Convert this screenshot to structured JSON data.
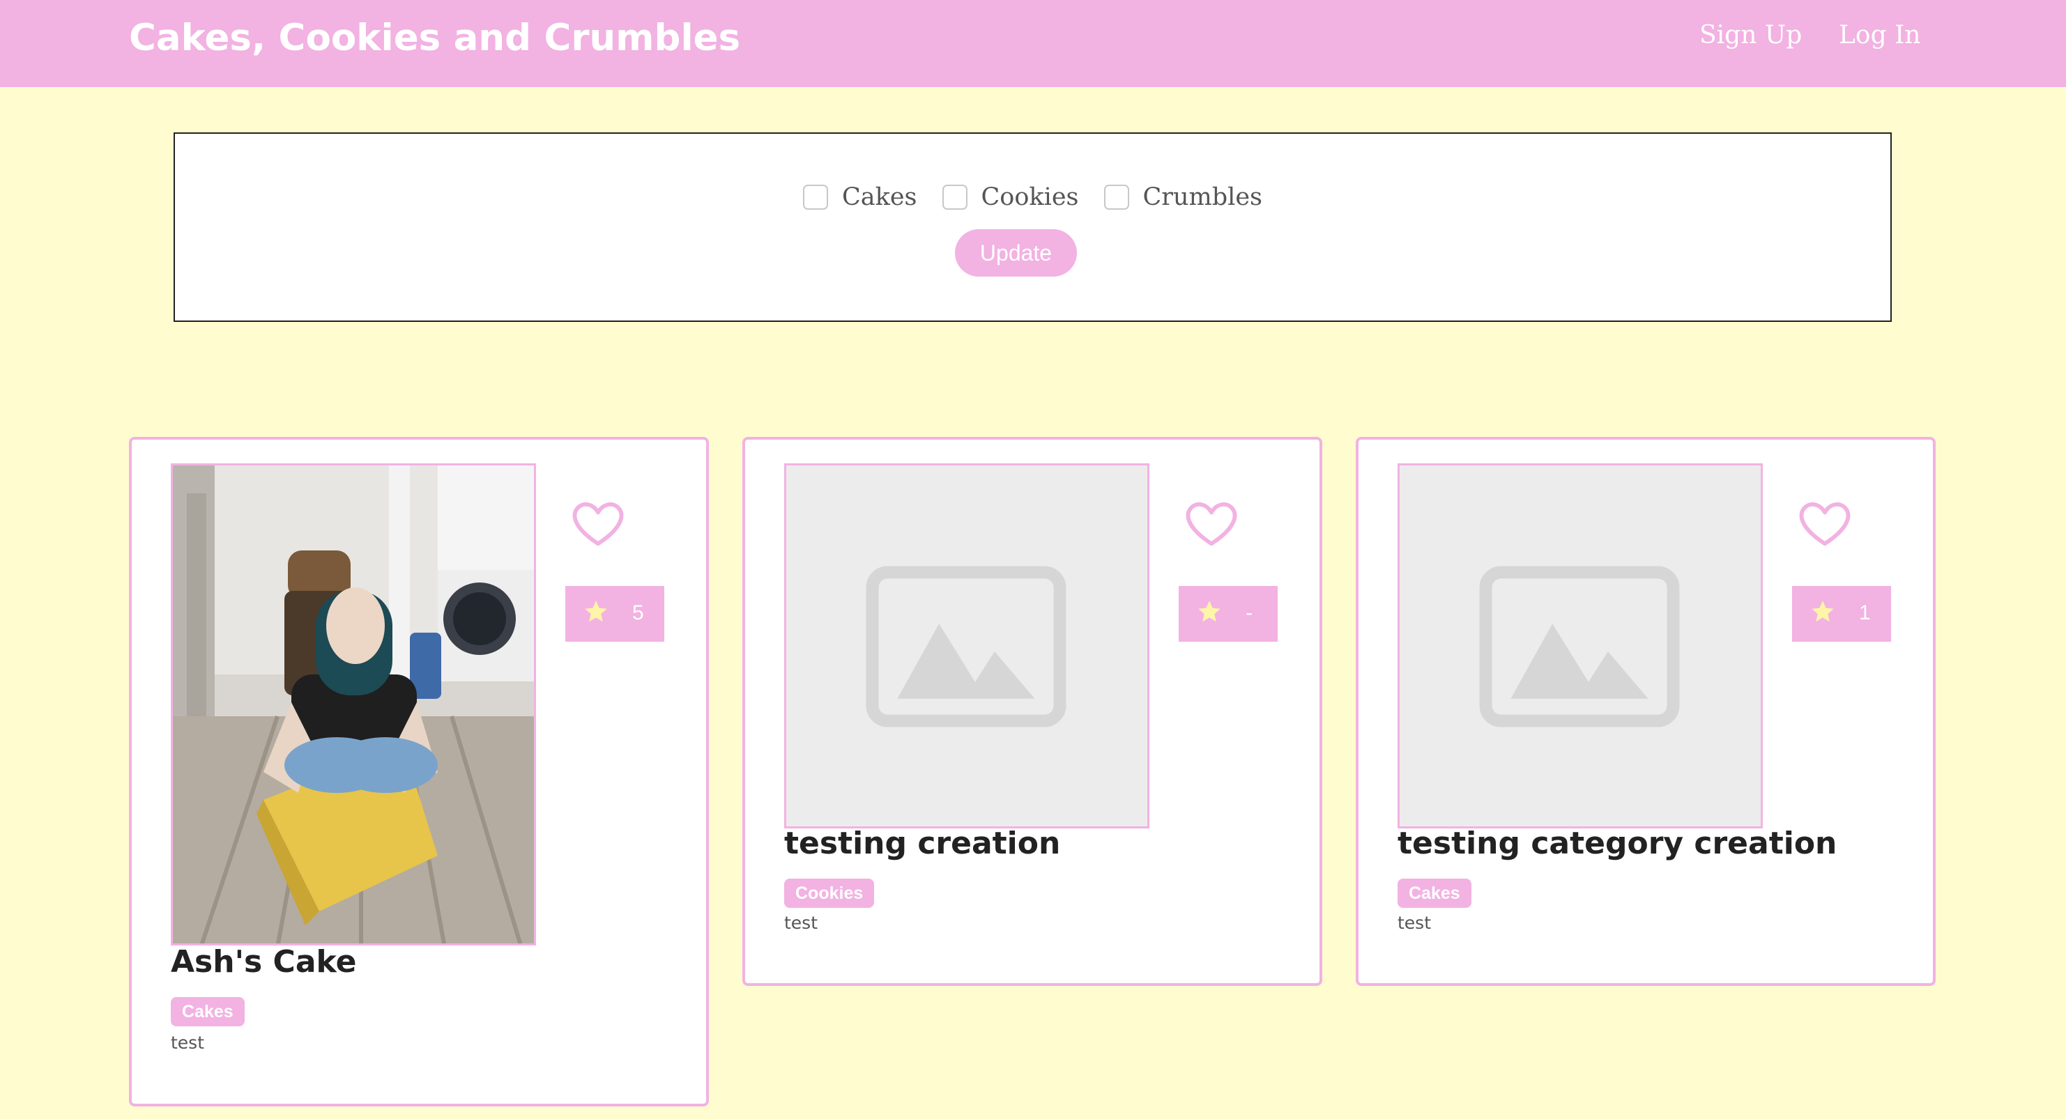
{
  "nav": {
    "brand": "Cakes, Cookies and Crumbles",
    "links": [
      "Sign Up",
      "Log In"
    ]
  },
  "filters": {
    "options": [
      "Cakes",
      "Cookies",
      "Crumbles"
    ],
    "update_label": "Update"
  },
  "cards": [
    {
      "title": "Ash's Cake",
      "category": "Cakes",
      "description": "test",
      "rating": "5",
      "image": "photo"
    },
    {
      "title": "testing creation",
      "category": "Cookies",
      "description": "test",
      "rating": "-",
      "image": "image-placeholder-icon"
    },
    {
      "title": "testing category creation",
      "category": "Cakes",
      "description": "test",
      "rating": "1",
      "image": "image-placeholder-icon"
    }
  ],
  "colors": {
    "accent": "#f2b2e2",
    "background": "#fffdd0",
    "star": "#fff5a8"
  }
}
